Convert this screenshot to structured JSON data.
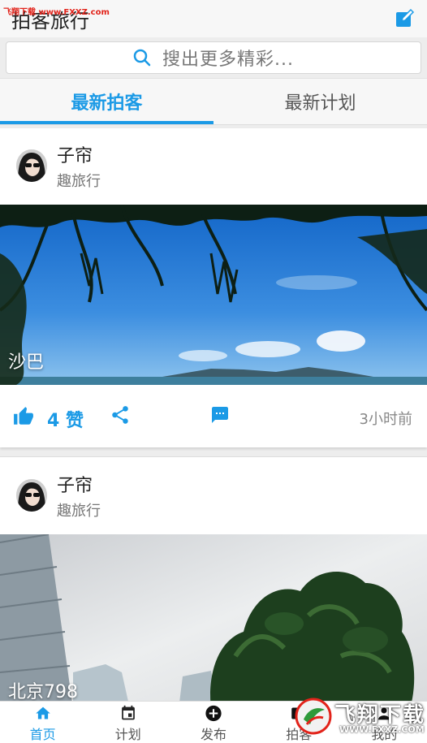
{
  "watermark": {
    "top_left": "飞翔下载 www.FXXZ.com",
    "logo": "飞翔下载",
    "domain": "WWW.FXXZ.COM"
  },
  "header": {
    "title": "拍客旅行",
    "edit_icon": "edit-icon"
  },
  "search": {
    "placeholder": "搜出更多精彩...",
    "icon": "search-icon"
  },
  "tabs": [
    {
      "label": "最新拍客",
      "active": true
    },
    {
      "label": "最新计划",
      "active": false
    }
  ],
  "posts": [
    {
      "author": "子帘",
      "source": "趣旅行",
      "photo_caption": "沙巴",
      "likes": "4 赞",
      "time": "3小时前"
    },
    {
      "author": "子帘",
      "source": "趣旅行",
      "photo_caption": "北京798"
    }
  ],
  "bottom_nav": [
    {
      "label": "首页",
      "icon": "home-icon",
      "active": true
    },
    {
      "label": "计划",
      "icon": "calendar-icon",
      "active": false
    },
    {
      "label": "发布",
      "icon": "add-circle-icon",
      "active": false
    },
    {
      "label": "拍客",
      "icon": "camera-icon",
      "active": false
    },
    {
      "label": "我的",
      "icon": "profile-icon",
      "active": false
    }
  ],
  "colors": {
    "accent": "#1b9ae6",
    "background": "#ededed",
    "header": "#f7f7f7"
  }
}
